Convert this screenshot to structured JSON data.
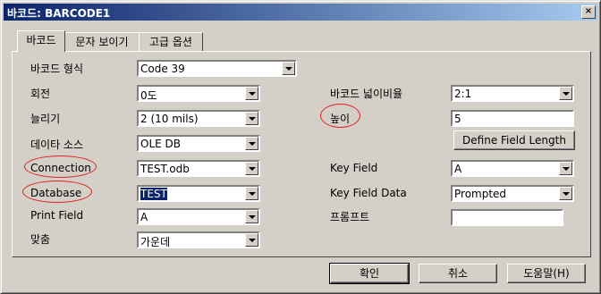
{
  "window": {
    "title": "바코드: BARCODE1",
    "close_label": "×"
  },
  "tabs": [
    {
      "label": "바코드"
    },
    {
      "label": "문자 보이기"
    },
    {
      "label": "고급 옵션"
    }
  ],
  "left": {
    "barcode_type": {
      "label": "바코드 형식",
      "value": "Code 39"
    },
    "rotation": {
      "label": "회전",
      "value": "0도"
    },
    "stretch": {
      "label": "늘리기",
      "value": "2  (10 mils)"
    },
    "data_source": {
      "label": "데이타 소스",
      "value": "OLE DB"
    },
    "connection": {
      "label": "Connection",
      "value": "TEST.odb"
    },
    "database": {
      "label": "Database",
      "value": "TEST"
    },
    "print_field": {
      "label": "Print Field",
      "value": "A"
    },
    "alignment": {
      "label": "맞춤",
      "value": "가운데"
    }
  },
  "right": {
    "width_ratio": {
      "label": "바코드 넓이비율",
      "value": "2:1"
    },
    "height": {
      "label": "높이",
      "value": "5"
    },
    "define_button": "Define Field Length",
    "key_field": {
      "label": "Key Field",
      "value": "A"
    },
    "key_field_data": {
      "label": "Key Field Data",
      "value": "Prompted"
    },
    "prompt": {
      "label": "프롬프트",
      "value": ""
    }
  },
  "footer": {
    "ok": "확인",
    "cancel": "취소",
    "help": "도움말(H)"
  },
  "colors": {
    "highlight_circle": "#e02020",
    "title_bg": "#0a246a"
  }
}
